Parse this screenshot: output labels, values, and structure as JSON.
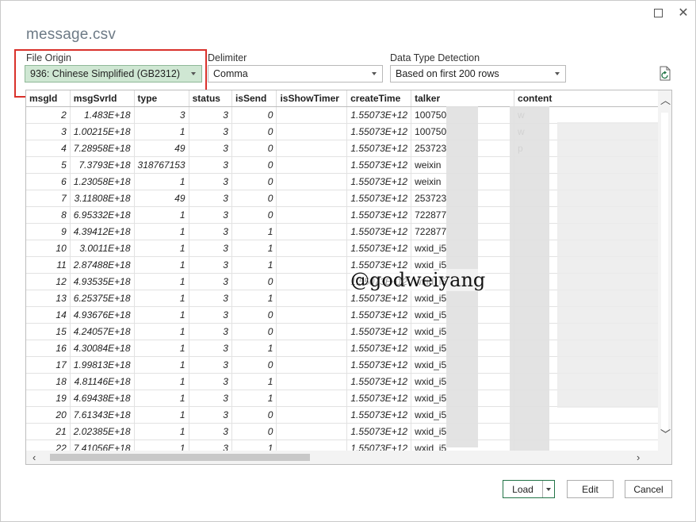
{
  "window": {
    "title": "message.csv",
    "maximize_icon": "maximize-icon",
    "close_icon": "close-icon"
  },
  "options": {
    "file_origin": {
      "label": "File Origin",
      "value": "936: Chinese Simplified (GB2312)"
    },
    "delimiter": {
      "label": "Delimiter",
      "value": "Comma"
    },
    "detection": {
      "label": "Data Type Detection",
      "value": "Based on first 200 rows"
    },
    "refresh_icon": "refresh-file-icon"
  },
  "table": {
    "columns": [
      "msgId",
      "msgSvrId",
      "type",
      "status",
      "isSend",
      "isShowTimer",
      "createTime",
      "talker",
      "content"
    ],
    "rows": [
      [
        "2",
        "1.483E+18",
        "3",
        "3",
        "0",
        "",
        "1.55073E+12",
        "100750",
        "w"
      ],
      [
        "3",
        "1.00215E+18",
        "1",
        "3",
        "0",
        "",
        "1.55073E+12",
        "100750",
        "w"
      ],
      [
        "4",
        "7.28958E+18",
        "49",
        "3",
        "0",
        "",
        "1.55073E+12",
        "253723",
        "p"
      ],
      [
        "5",
        "7.3793E+18",
        "318767153",
        "3",
        "0",
        "",
        "1.55073E+12",
        "weixin",
        ""
      ],
      [
        "6",
        "1.23058E+18",
        "1",
        "3",
        "0",
        "",
        "1.55073E+12",
        "weixin",
        ""
      ],
      [
        "7",
        "3.11808E+18",
        "49",
        "3",
        "0",
        "",
        "1.55073E+12",
        "253723",
        ""
      ],
      [
        "8",
        "6.95332E+18",
        "1",
        "3",
        "0",
        "",
        "1.55073E+12",
        "722877",
        ""
      ],
      [
        "9",
        "4.39412E+18",
        "1",
        "3",
        "1",
        "",
        "1.55073E+12",
        "722877",
        ""
      ],
      [
        "10",
        "3.0011E+18",
        "1",
        "3",
        "1",
        "",
        "1.55073E+12",
        "wxid_i5",
        ""
      ],
      [
        "11",
        "2.87488E+18",
        "1",
        "3",
        "1",
        "",
        "1.55073E+12",
        "wxid_i5",
        ""
      ],
      [
        "12",
        "4.93535E+18",
        "1",
        "3",
        "0",
        "",
        "1.55073E+12",
        "wxid_i5",
        ""
      ],
      [
        "13",
        "6.25375E+18",
        "1",
        "3",
        "1",
        "",
        "1.55073E+12",
        "wxid_i5",
        ""
      ],
      [
        "14",
        "4.93676E+18",
        "1",
        "3",
        "0",
        "",
        "1.55073E+12",
        "wxid_i5",
        ""
      ],
      [
        "15",
        "4.24057E+18",
        "1",
        "3",
        "0",
        "",
        "1.55073E+12",
        "wxid_i5",
        ""
      ],
      [
        "16",
        "4.30084E+18",
        "1",
        "3",
        "1",
        "",
        "1.55073E+12",
        "wxid_i5",
        ""
      ],
      [
        "17",
        "1.99813E+18",
        "1",
        "3",
        "0",
        "",
        "1.55073E+12",
        "wxid_i5",
        ""
      ],
      [
        "18",
        "4.81146E+18",
        "1",
        "3",
        "1",
        "",
        "1.55073E+12",
        "wxid_i5",
        ""
      ],
      [
        "19",
        "4.69438E+18",
        "1",
        "3",
        "1",
        "",
        "1.55073E+12",
        "wxid_i5",
        ""
      ],
      [
        "20",
        "7.61343E+18",
        "1",
        "3",
        "0",
        "",
        "1.55073E+12",
        "wxid_i5",
        ""
      ],
      [
        "21",
        "2.02385E+18",
        "1",
        "3",
        "0",
        "",
        "1.55073E+12",
        "wxid_i5",
        ""
      ],
      [
        "22",
        "7.41056E+18",
        "1",
        "3",
        "1",
        "",
        "1.55073E+12",
        "wxid_i5",
        ""
      ]
    ]
  },
  "watermark": "@godweiyang",
  "buttons": {
    "load": "Load",
    "edit": "Edit",
    "cancel": "Cancel"
  },
  "colors": {
    "highlight": "#cfe7d3",
    "red_box": "#d9312b",
    "accent": "#217346"
  }
}
